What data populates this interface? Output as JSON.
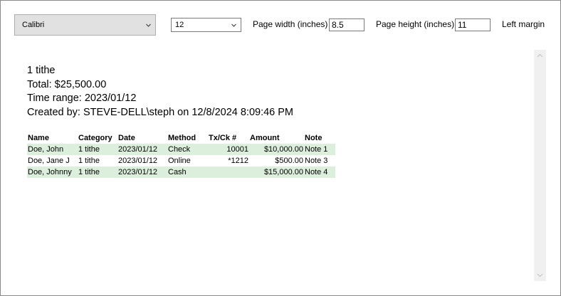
{
  "toolbar": {
    "font_combo": {
      "selected": "Calibri"
    },
    "size_combo": {
      "selected": "12"
    },
    "page_width": {
      "label": "Page width (inches)",
      "value": "8.5"
    },
    "page_height": {
      "label": "Page height (inches)",
      "value": "11"
    },
    "left_margin": {
      "label": "Left margin"
    }
  },
  "report": {
    "line1": "1 tithe",
    "line2": "Total: $25,500.00",
    "line3": "Time range: 2023/01/12",
    "line4": "Created by: STEVE-DELL\\steph on 12/8/2024 8:09:46 PM",
    "columns": {
      "name": "Name",
      "category": "Category",
      "date": "Date",
      "method": "Method",
      "tx": "Tx/Ck #",
      "amount": "Amount",
      "note": "Note"
    },
    "rows": [
      {
        "name": "Doe, John",
        "category": "1 tithe",
        "date": "2023/01/12",
        "method": "Check",
        "tx": "10001",
        "amount": "$10,000.00",
        "note": "Note 1"
      },
      {
        "name": "Doe, Jane J",
        "category": "1 tithe",
        "date": "2023/01/12",
        "method": "Online",
        "tx": "*1212",
        "amount": "$500.00",
        "note": "Note 3"
      },
      {
        "name": "Doe, Johnny",
        "category": "1 tithe",
        "date": "2023/01/12",
        "method": "Cash",
        "tx": "",
        "amount": "$15,000.00",
        "note": "Note 4"
      }
    ]
  },
  "colors": {
    "row_highlight": "#dcefdc",
    "combo_bg": "#e1e1e1",
    "scrollbar_bg": "#f0f0f0"
  },
  "icons": {
    "combo_arrow": "chevron-down-icon",
    "scroll_up": "chevron-up-icon",
    "scroll_down": "chevron-down-icon"
  }
}
